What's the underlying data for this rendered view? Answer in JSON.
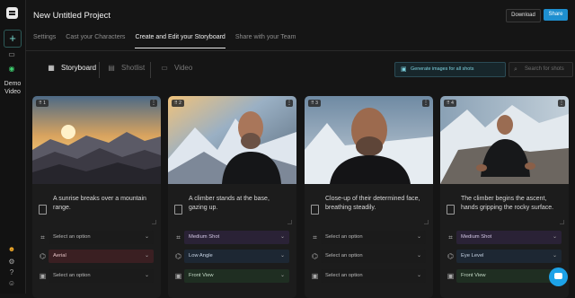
{
  "app": {
    "title": "New Untitled Project"
  },
  "header": {
    "download_label": "Download",
    "share_label": "Share"
  },
  "sidebar": {
    "demo_label_1": "Demo",
    "demo_label_2": "Video",
    "help_label": "?"
  },
  "tabs": [
    {
      "label": "Settings"
    },
    {
      "label": "Cast your Characters"
    },
    {
      "label": "Create and Edit your Storyboard"
    },
    {
      "label": "Share with your Team"
    }
  ],
  "view_tabs": [
    {
      "label": "Storyboard",
      "icon": "grid-icon"
    },
    {
      "label": "Shotlist",
      "icon": "table-icon"
    },
    {
      "label": "Video",
      "icon": "video-icon"
    }
  ],
  "toolbar": {
    "generate_label": "Generate images for all shots",
    "search_placeholder": "Search for shots"
  },
  "cards": [
    {
      "num": "1",
      "desc": "A sunrise breaks over a mountain range.",
      "shot": "Select an option",
      "angle": "Aerial",
      "view": "Select an option"
    },
    {
      "num": "2",
      "desc": "A climber stands at the base, gazing up.",
      "shot": "Medium Shot",
      "angle": "Low Angle",
      "view": "Front View"
    },
    {
      "num": "3",
      "desc": "Close-up of their determined face, breathing steadily.",
      "shot": "Select an option",
      "angle": "Select an option",
      "view": "Select an option"
    },
    {
      "num": "4",
      "desc": "The climber begins the ascent, hands gripping the rocky surface.",
      "shot": "Medium Shot",
      "angle": "Eye Level",
      "view": "Front View"
    }
  ],
  "colors": {
    "accent": "#1e8fd0",
    "teal": "#7ed3e0",
    "background": "#151515"
  }
}
